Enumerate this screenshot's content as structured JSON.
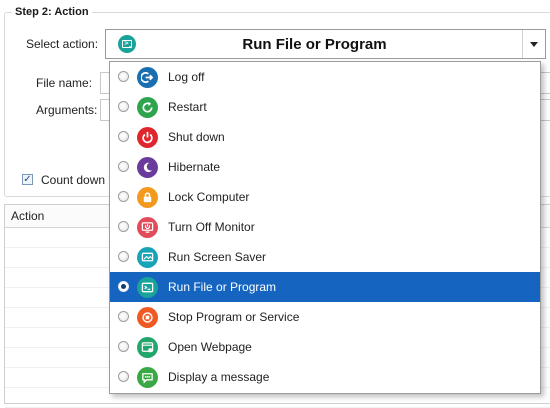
{
  "group": {
    "title": "Step 2: Action"
  },
  "form": {
    "select_action_label": "Select action:",
    "selected_action": "Run File or Program",
    "file_name_label": "File name:",
    "arguments_label": "Arguments:",
    "count_down_label": "Count down",
    "count_down_checked": true
  },
  "table": {
    "column_action": "Action"
  },
  "dropdown": {
    "items": [
      {
        "label": "Log off",
        "icon": "log-off-icon",
        "color": "#1a6fb0",
        "selected": false
      },
      {
        "label": "Restart",
        "icon": "restart-icon",
        "color": "#2ea44f",
        "selected": false
      },
      {
        "label": "Shut down",
        "icon": "power-icon",
        "color": "#e0262d",
        "selected": false
      },
      {
        "label": "Hibernate",
        "icon": "moon-icon",
        "color": "#6a3a9c",
        "selected": false
      },
      {
        "label": "Lock Computer",
        "icon": "lock-icon",
        "color": "#f39a1e",
        "selected": false
      },
      {
        "label": "Turn Off Monitor",
        "icon": "monitor-off-icon",
        "color": "#e24b5a",
        "selected": false
      },
      {
        "label": "Run Screen Saver",
        "icon": "screen-saver-icon",
        "color": "#18a3b8",
        "selected": false
      },
      {
        "label": "Run File or Program",
        "icon": "terminal-icon",
        "color": "#1aa39a",
        "selected": true
      },
      {
        "label": "Stop Program or Service",
        "icon": "stop-icon",
        "color": "#ef5a24",
        "selected": false
      },
      {
        "label": "Open Webpage",
        "icon": "webpage-icon",
        "color": "#21a66b",
        "selected": false
      },
      {
        "label": "Display a message",
        "icon": "message-icon",
        "color": "#3aa845",
        "selected": false
      }
    ]
  }
}
